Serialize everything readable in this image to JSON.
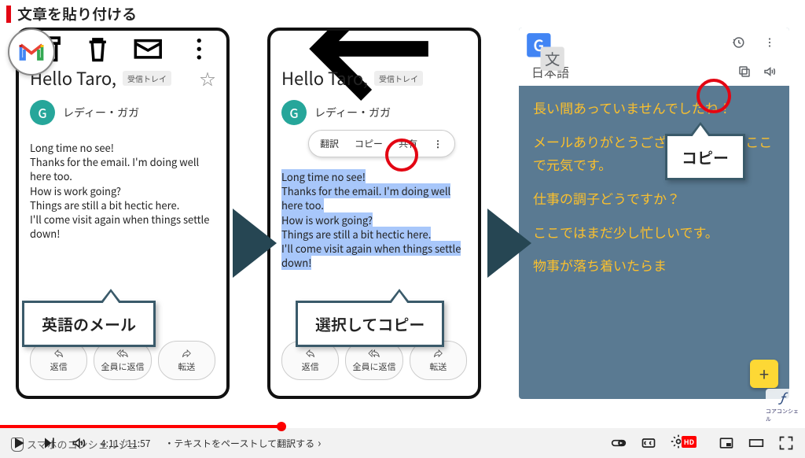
{
  "title": "文章を貼り付ける",
  "gmail": {
    "subject": "Hello Taro,",
    "tray_label": "受信トレイ",
    "sender_initial": "G",
    "sender_name": "レディー・ガガ",
    "body_lines": [
      "Long time no see!",
      "Thanks for the email. I'm doing well here too.",
      "How is work going?",
      "Things are still a bit hectic here.",
      "I'll come visit again when things settle down!"
    ],
    "actions": {
      "reply": "返信",
      "reply_all": "全員に返信",
      "forward": "転送"
    },
    "context_menu": {
      "translate": "翻訳",
      "copy": "コピー",
      "share": "共有"
    }
  },
  "translate": {
    "lang": "日本語",
    "paragraphs": [
      "長い間あっていませんでしたね！",
      "メールありがとうございます。私もここで元気です。",
      "仕事の調子どうですか？",
      "ここではまだ少し忙しいです。",
      "物事が落ち着いたらま"
    ]
  },
  "callouts": {
    "english_mail": "英語のメール",
    "select_copy": "選択してコピー",
    "copy": "コピー"
  },
  "youtube": {
    "current": "4:11",
    "duration": "11:57",
    "chapter": "・テキストをペーストして翻訳する",
    "hd": "HD",
    "channel": "スマホのコンシェルジュ",
    "watermark": "コアコンシェル"
  }
}
